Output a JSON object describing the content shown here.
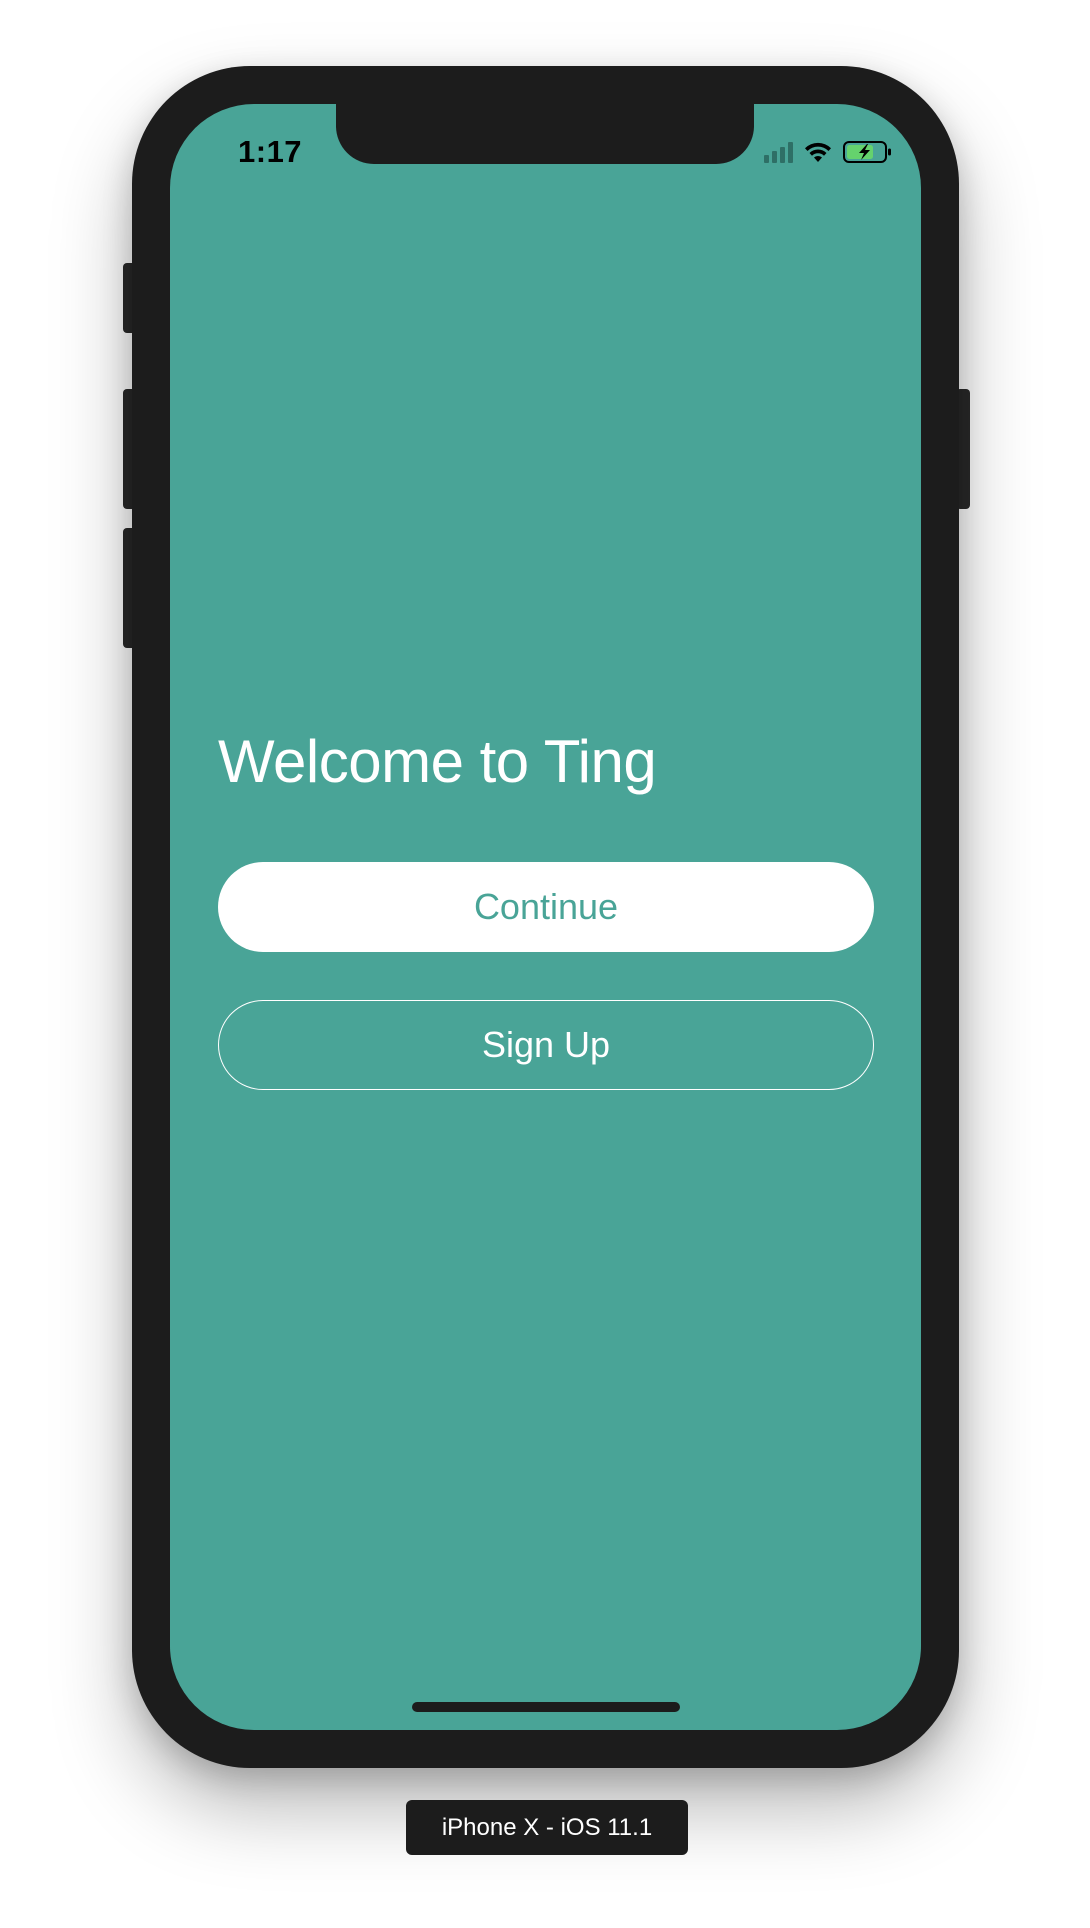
{
  "status_bar": {
    "time": "1:17",
    "signal_icon": "cellular-signal-icon",
    "wifi_icon": "wifi-icon",
    "battery_icon": "battery-charging-icon"
  },
  "welcome": {
    "title": "Welcome to Ting"
  },
  "buttons": {
    "continue_label": "Continue",
    "signup_label": "Sign Up"
  },
  "device": {
    "label": "iPhone X - iOS 11.1"
  },
  "colors": {
    "accent": "#49a497",
    "frame": "#1c1c1c",
    "text_on_accent": "#ffffff",
    "battery_charge": "#65d26d"
  }
}
